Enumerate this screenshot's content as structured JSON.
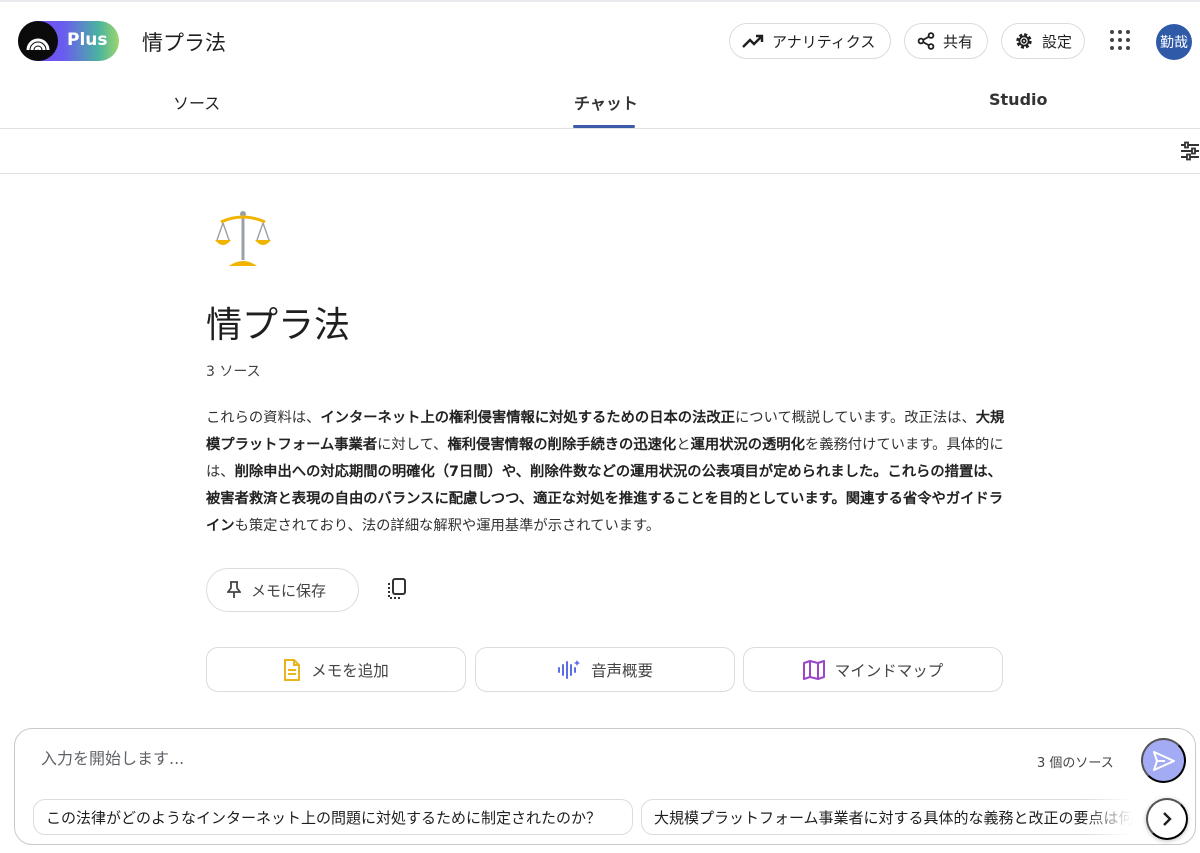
{
  "header": {
    "brand_badge": "Plus",
    "notebook_title": "情プラ法",
    "analytics_label": "アナリティクス",
    "share_label": "共有",
    "settings_label": "設定",
    "avatar_text": "勤哉"
  },
  "tabs": [
    {
      "label": "ソース"
    },
    {
      "label": "チャット"
    },
    {
      "label": "Studio"
    }
  ],
  "notebook": {
    "emoji": "⚖️",
    "title": "情プラ法",
    "source_count": "3 ソース"
  },
  "summary_parts": [
    {
      "text": "これらの資料は、",
      "bold": false
    },
    {
      "text": "インターネット上の権利侵害情報に対処するための日本の法改正",
      "bold": true
    },
    {
      "text": "について概説しています。改正法は、",
      "bold": false
    },
    {
      "text": "大規模プラットフォーム事業者",
      "bold": true
    },
    {
      "text": "に対して、",
      "bold": false
    },
    {
      "text": "権利侵害情報の削除手続きの迅速化",
      "bold": true
    },
    {
      "text": "と",
      "bold": false
    },
    {
      "text": "運用状況の透明化",
      "bold": true
    },
    {
      "text": "を義務付けています。具体的には、",
      "bold": false
    },
    {
      "text": "削除申出への対応期間の明確化（7日間）や、削除件数などの運用状況の公表項目が定められました。これらの措置は、被害者救済と表現の自由のバランスに配慮しつつ、適正な対処を推進することを目的としています。関連する省令やガイドライン",
      "bold": true
    },
    {
      "text": "も策定されており、法の詳細な解釈や運用基準が示されています。",
      "bold": false
    }
  ],
  "actions": {
    "save_to_memo": "メモに保存",
    "add_memo": "メモを追加",
    "audio_overview": "音声概要",
    "mind_map": "マインドマップ"
  },
  "composer": {
    "placeholder": "入力を開始します...",
    "source_count": "3 個のソース"
  },
  "suggestions": [
    "この法律がどのようなインターネット上の問題に対処するために制定されたのか？",
    "大規模プラットフォーム事業者に対する具体的な義務と改正の要点は何"
  ],
  "colors": {
    "accent": "#3b5ba9",
    "send_button": "#a3abf5",
    "memo_icon": "#e9b51f",
    "audio_icon": "#5a6ee8",
    "mindmap_icon": "#9b45c9"
  }
}
